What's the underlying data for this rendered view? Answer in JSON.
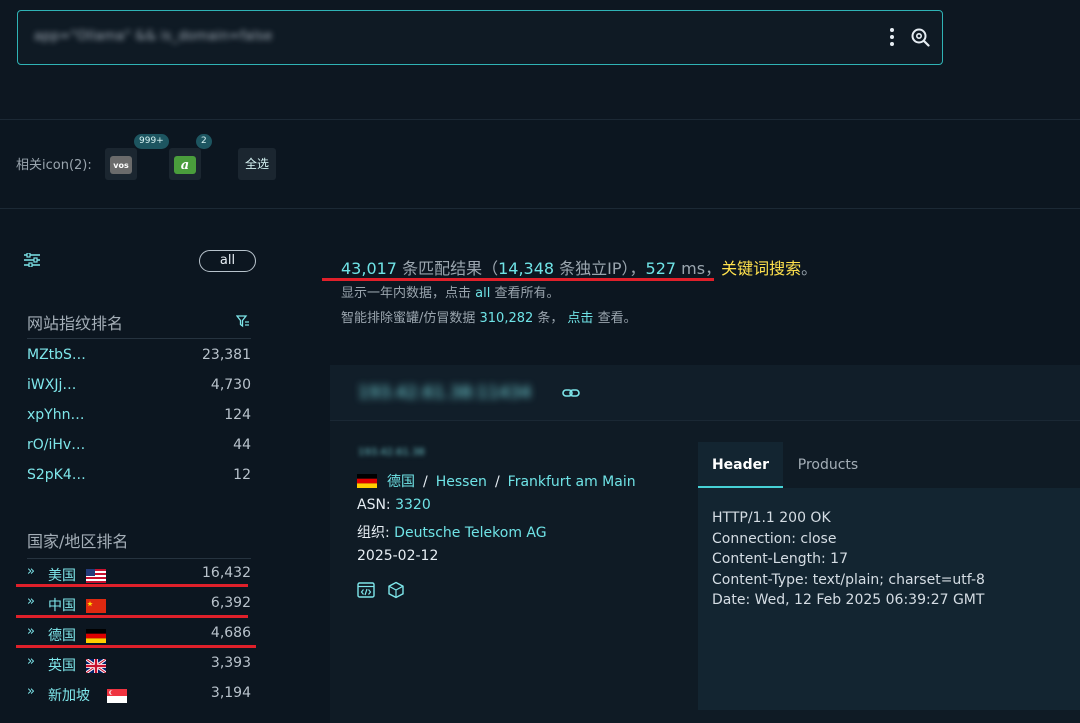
{
  "search": {
    "query": "app=\"Ollama\" && is_domain=false"
  },
  "icon_bar": {
    "label": "相关icon(2):",
    "icons": [
      {
        "name": "vos",
        "text": "vos",
        "badge": "999+"
      },
      {
        "name": "a",
        "text": "a",
        "badge": "2"
      }
    ],
    "select_all": "全选"
  },
  "sidebar": {
    "all_label": "all",
    "fingerprint_title": "网站指纹排名",
    "fingerprints": [
      {
        "name": "MZtbS…",
        "count": "23,381"
      },
      {
        "name": "iWXJj…",
        "count": "4,730"
      },
      {
        "name": "xpYhn…",
        "count": "124"
      },
      {
        "name": "rO/iHv…",
        "count": "44"
      },
      {
        "name": "S2pK4…",
        "count": "12"
      }
    ],
    "country_title": "国家/地区排名",
    "countries": [
      {
        "name": "美国",
        "count": "16,432",
        "flag": "us"
      },
      {
        "name": "中国",
        "count": "6,392",
        "flag": "cn"
      },
      {
        "name": "德国",
        "count": "4,686",
        "flag": "de"
      },
      {
        "name": "英国",
        "count": "3,393",
        "flag": "gb"
      },
      {
        "name": "新加坡",
        "count": "3,194",
        "flag": "sg"
      }
    ]
  },
  "summary": {
    "total": "43,017",
    "total_suffix": " 条匹配结果（",
    "unique_ip": "14,348",
    "unique_suffix": " 条独立IP），",
    "ms": "527",
    "ms_suffix": " ms，",
    "keyword": "关键词搜索",
    "end": "。",
    "line2_a": "显示一年内数据，点击 ",
    "line2_all": "all",
    "line2_b": " 查看所有。",
    "line3_a": "智能排除蜜罐/仿冒数据 ",
    "line3_count": "310,282",
    "line3_b": " 条，",
    "line3_click": "点击",
    "line3_c": " 查看。"
  },
  "result": {
    "ip_port": "193.42.61.38:11434",
    "ip_sub": "193.42.61.38",
    "country": "德国",
    "region": "Hessen",
    "city": "Frankfurt am Main",
    "asn_label": "ASN: ",
    "asn": "3320",
    "org_label": "组织: ",
    "org": "Deutsche Telekom AG",
    "date": "2025-02-12",
    "tabs": [
      "Header",
      "Products"
    ],
    "header_lines": [
      "HTTP/1.1 200 OK",
      "Connection: close",
      "Content-Length: 17",
      "Content-Type: text/plain; charset=utf-8",
      "Date: Wed, 12 Feb 2025 06:39:27 GMT"
    ]
  },
  "colors": {
    "accent": "#6fe3e6",
    "keyword": "#ffe14d",
    "highlight": "#e0202a",
    "background": "#0c1620"
  }
}
